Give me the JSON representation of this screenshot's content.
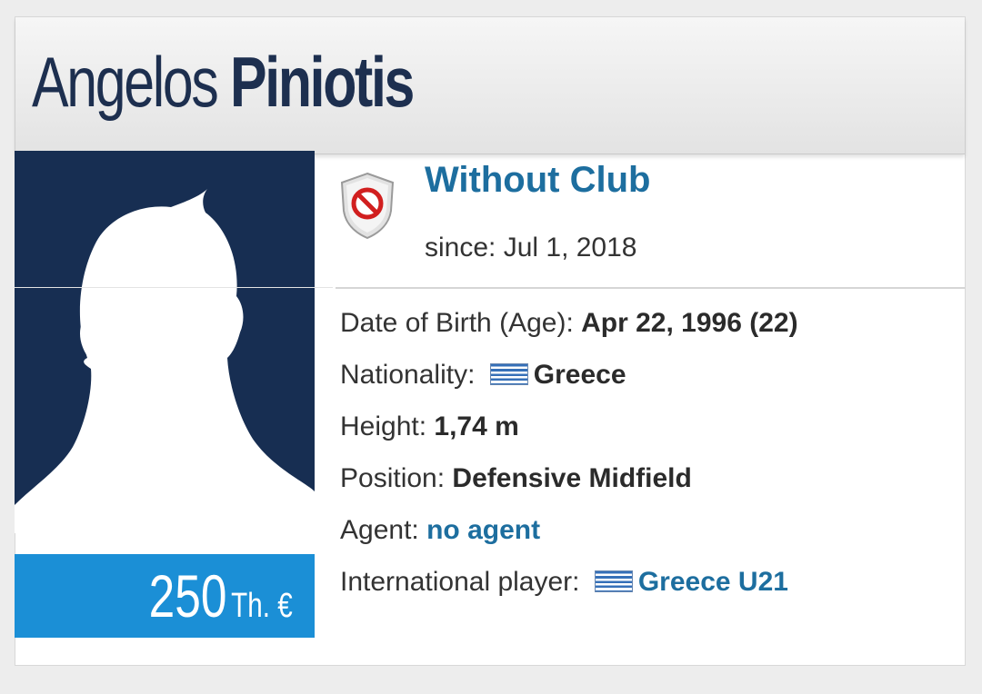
{
  "player": {
    "first_name": "Angelos",
    "last_name": "Piniotis"
  },
  "market_value": {
    "amount": "250",
    "unit": "Th. €"
  },
  "club": {
    "name": "Without Club",
    "since": "since: Jul 1, 2018",
    "crest_icon": "no-entry-shield-icon"
  },
  "details": {
    "dob_label": "Date of Birth (Age):",
    "dob_value": "Apr 22, 1996 (22)",
    "nationality_label": "Nationality:",
    "nationality_value": "Greece",
    "height_label": "Height:",
    "height_value": "1,74 m",
    "position_label": "Position:",
    "position_value": "Defensive Midfield",
    "agent_label": "Agent:",
    "agent_value": "no agent",
    "international_label": "International player:",
    "international_value": "Greece U21"
  },
  "colors": {
    "header_text": "#1d2f4f",
    "link": "#1d6e9f",
    "photo_bg": "#172e52",
    "value_bg": "#1b8fd6"
  }
}
